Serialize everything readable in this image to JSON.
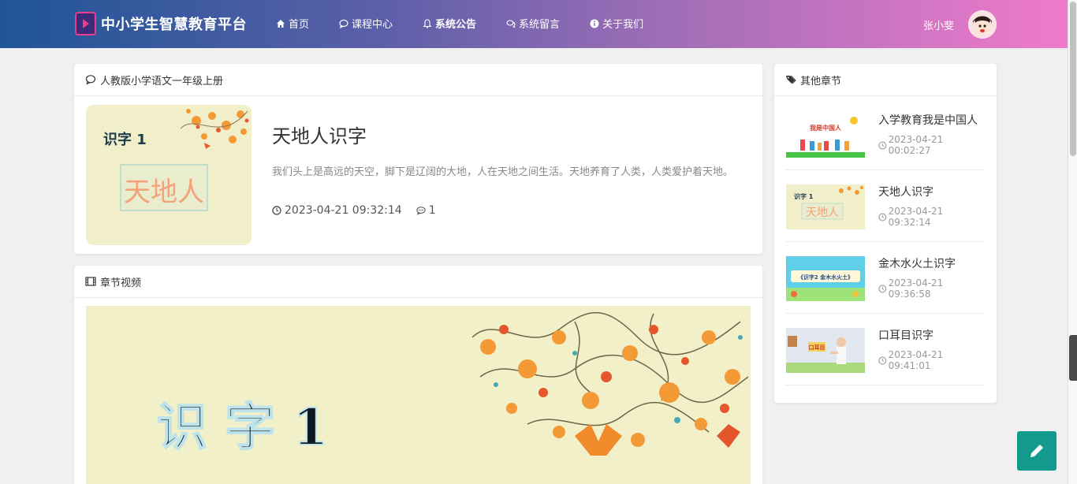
{
  "brand": {
    "title": "中小学生智慧教育平台"
  },
  "nav": {
    "items": [
      {
        "label": "首页",
        "icon": "home-icon"
      },
      {
        "label": "课程中心",
        "icon": "comment-icon"
      },
      {
        "label": "系统公告",
        "icon": "bell-icon"
      },
      {
        "label": "系统留言",
        "icon": "comments-icon"
      },
      {
        "label": "关于我们",
        "icon": "info-circle-icon"
      }
    ],
    "user_name": "张小斐"
  },
  "course": {
    "header": "人教版小学语文一年级上册",
    "title": "天地人识字",
    "description": "我们头上是高远的天空，脚下是辽阔的大地，人在天地之间生活。天地养育了人类，人类爱护着天地。",
    "date": "2023-04-21 09:32:14",
    "comments": "1",
    "thumb_text_top": "识字 1",
    "thumb_text_main": "天地人"
  },
  "video": {
    "header": "章节视频",
    "frame_text": "识 字  1"
  },
  "side": {
    "header": "其他章节",
    "items": [
      {
        "title": "入学教育我是中国人",
        "time": "2023-04-21 00:02:27",
        "thumb_text": "我是中国人"
      },
      {
        "title": "天地人识字",
        "time": "2023-04-21 09:32:14",
        "thumb_text": "天地人"
      },
      {
        "title": "金木水火土识字",
        "time": "2023-04-21 09:36:58",
        "thumb_text": "《识字2 金木水火土》"
      },
      {
        "title": "口耳目识字",
        "time": "2023-04-21 09:41:01",
        "thumb_text": "口耳目"
      }
    ]
  },
  "colors": {
    "fab": "#139a8c",
    "nav_start": "#1f5596",
    "nav_end": "#f07acb"
  }
}
